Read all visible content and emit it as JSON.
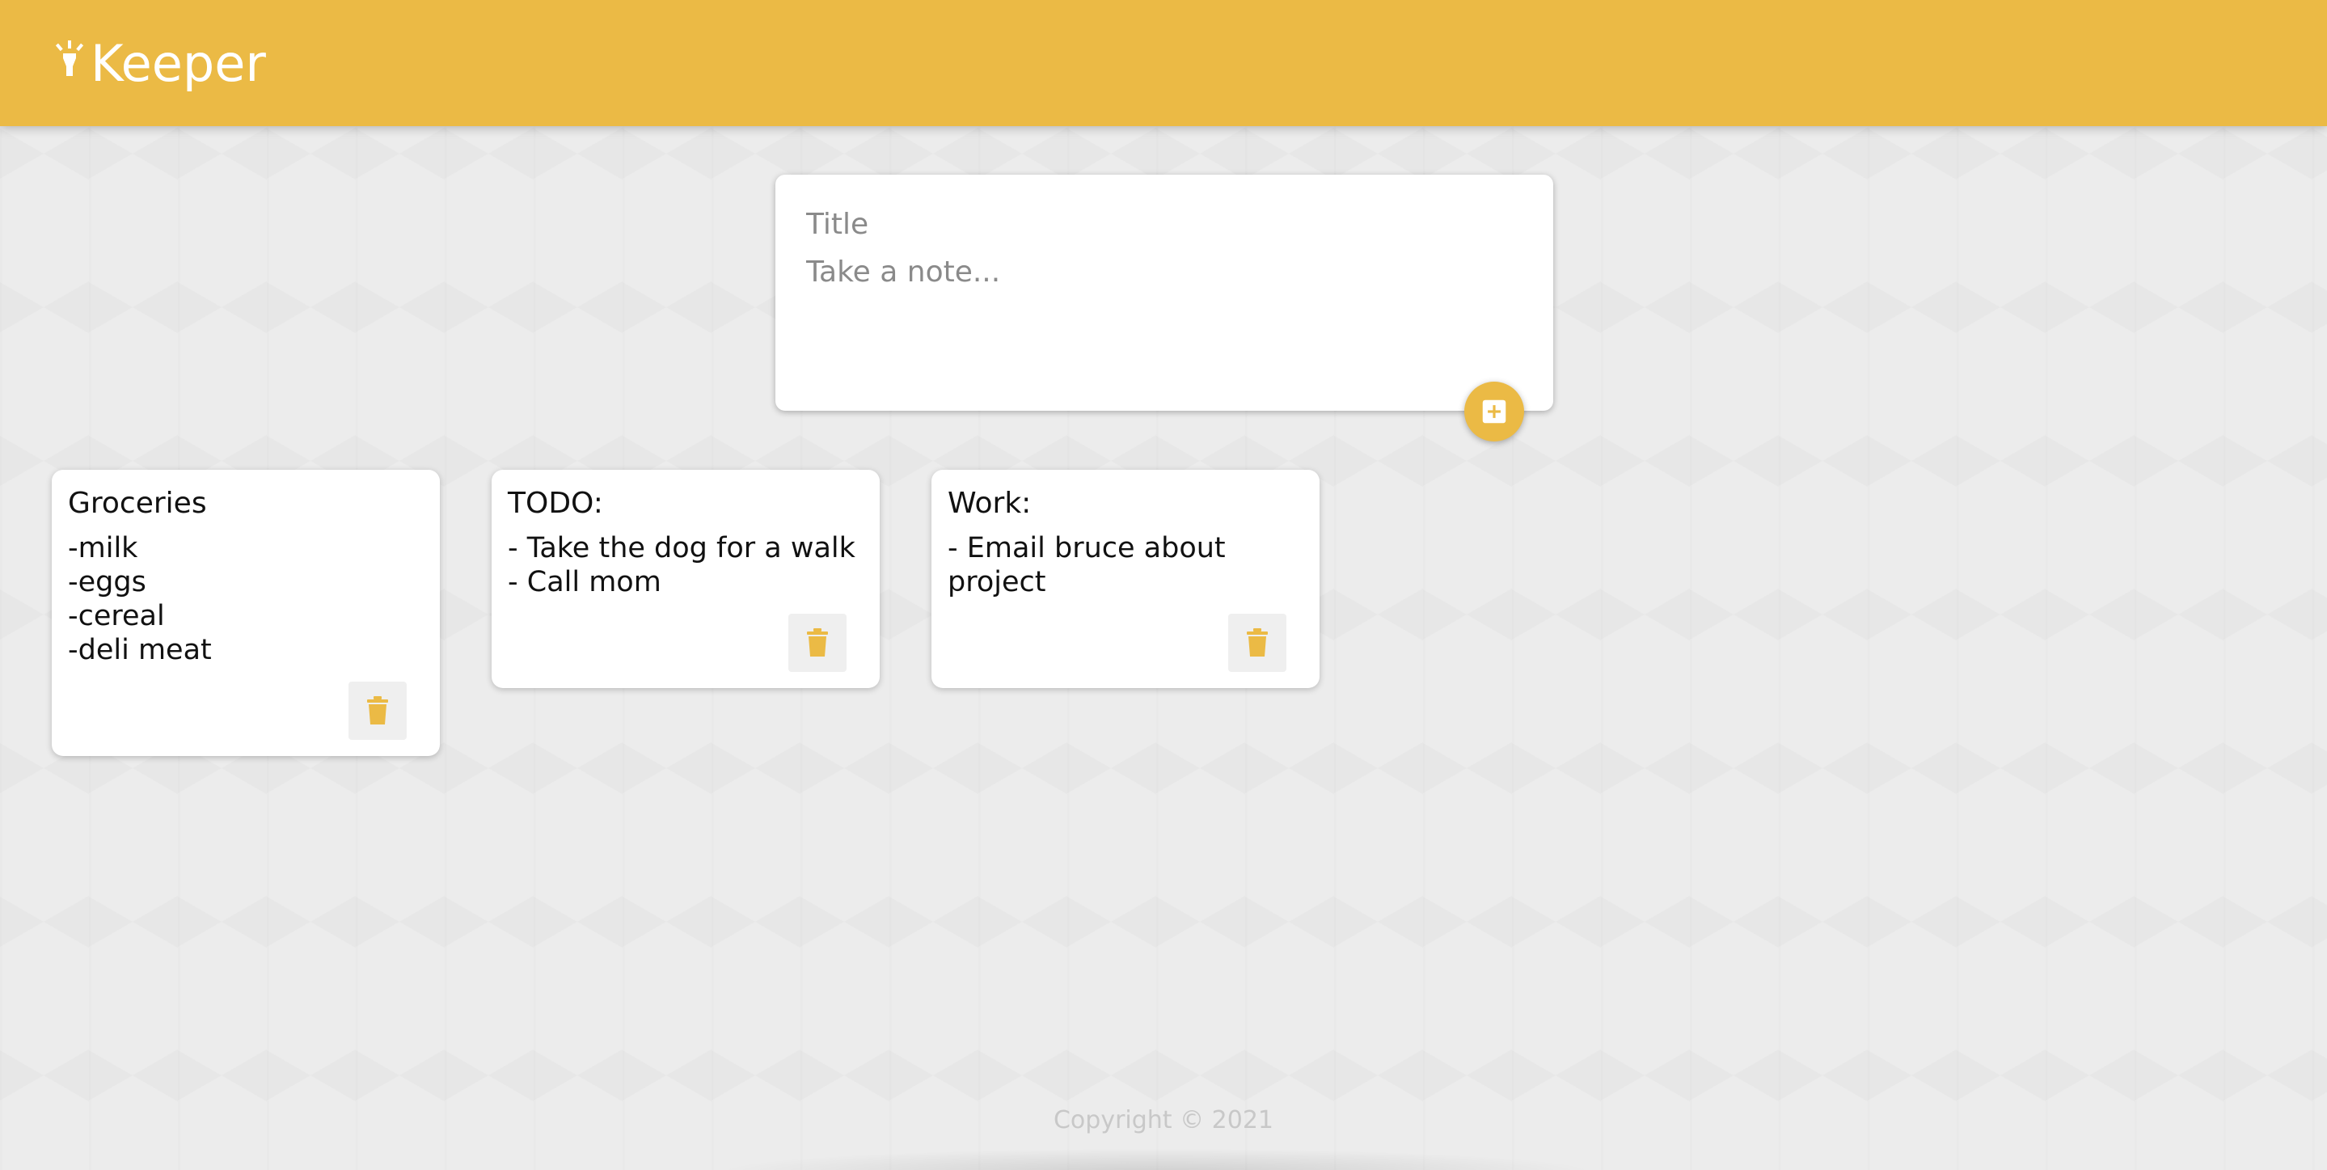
{
  "app": {
    "title": "Keeper",
    "accent_color": "#ebba45"
  },
  "header": {
    "logo_icon": "highlight-icon",
    "title": "Keeper"
  },
  "composer": {
    "title_placeholder": "Title",
    "content_placeholder": "Take a note...",
    "add_button_icon": "add-box-icon"
  },
  "notes": [
    {
      "title": "Groceries",
      "content": "-milk\n-eggs\n-cereal\n-deli meat",
      "delete_icon": "trash-icon"
    },
    {
      "title": "TODO:",
      "content": "- Take the dog for a walk\n- Call mom",
      "delete_icon": "trash-icon"
    },
    {
      "title": "Work:",
      "content": "- Email bruce about\nproject",
      "delete_icon": "trash-icon"
    }
  ],
  "footer": {
    "copyright": "Copyright © 2021"
  }
}
